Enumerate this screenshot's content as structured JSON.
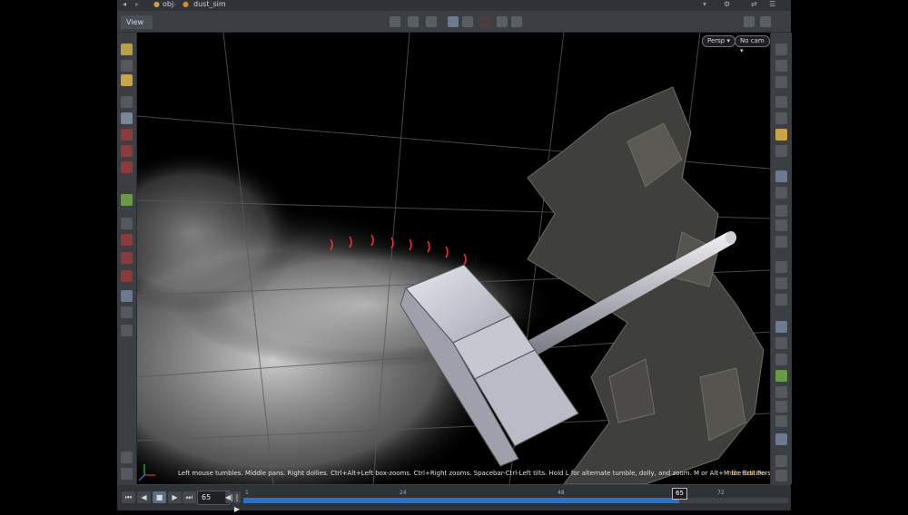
{
  "path": {
    "node1": "obj",
    "node2": "dust_sim"
  },
  "viewer": {
    "tab_label": "View",
    "persp_label": "Persp ▾",
    "cam_label": "No cam ▾"
  },
  "status": {
    "hint": "Left mouse tumbles. Middle pans. Right dollies. Ctrl+Alt+Left box-zooms. Ctrl+Right zooms. Spacebar-Ctrl-Left tilts. Hold L for alternate tumble, dolly, and zoom.    M or Alt+M for First Person Navigation.",
    "edition": "ndie Edition"
  },
  "timeline": {
    "current_frame": "65",
    "ticks": [
      "1",
      "24",
      "48",
      "72"
    ],
    "marker": "65",
    "progress": 0.8
  },
  "buttons": {
    "first": "⏮",
    "prev": "◀",
    "stop": "■",
    "play": "▶",
    "last": "⏭",
    "step_back": "◀|",
    "step_fwd": "|▶"
  }
}
